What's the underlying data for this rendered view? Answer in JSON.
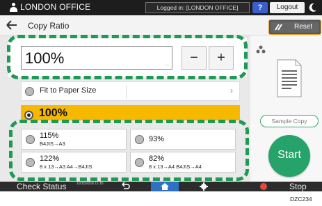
{
  "topbar": {
    "office_name": "LONDON OFFICE",
    "login_status": "Logged in: [LONDON OFFICE]",
    "help_label": "?",
    "logout_label": "Logout"
  },
  "header": {
    "title": "Copy Ratio",
    "reset_label": "Reset"
  },
  "ratio": {
    "value": "100%",
    "more_indicator": "...",
    "minus_label": "−",
    "plus_label": "+"
  },
  "fit_option": {
    "label": "Fit to Paper Size"
  },
  "selected_option": {
    "label": "100%"
  },
  "presets": [
    {
      "main": "115%",
      "sub": "B4JIS→A3"
    },
    {
      "main": "93%",
      "sub": ""
    },
    {
      "main": "122%",
      "sub": "8 x 13→A3   A4→B4JIS"
    },
    {
      "main": "82%",
      "sub": "8 x 13→A4   B4JIS→A4"
    }
  ],
  "right_panel": {
    "sample_copy_label": "Sample Copy",
    "start_label": "Start"
  },
  "bottombar": {
    "check_status_label": "Check Status",
    "datetime": "10/10/2016 11:16",
    "stop_label": "Stop"
  },
  "figure_code": "DZC234",
  "colors": {
    "accent_green": "#26a36a",
    "selected_yellow": "#f6b800",
    "home_blue": "#2f6fc4",
    "stop_red": "#e5483a",
    "reset_border_orange": "#e6a01f"
  }
}
